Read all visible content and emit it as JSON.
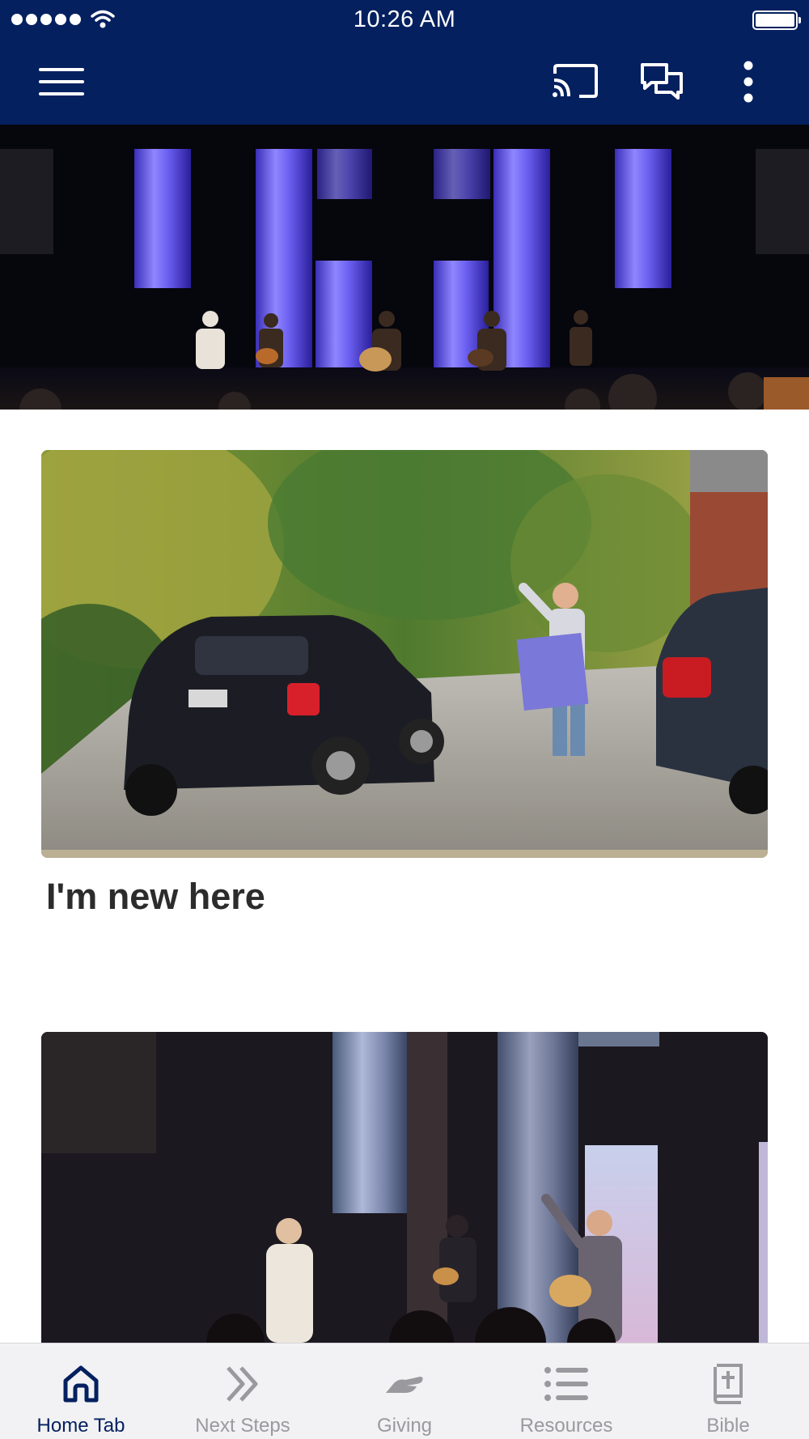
{
  "status_bar": {
    "time": "10:26 AM"
  },
  "header": {
    "menu_icon": "hamburger-icon",
    "cast_icon": "cast-icon",
    "chat_icon": "chat-icon",
    "more_icon": "more-vertical-icon",
    "background_color": "#04205f"
  },
  "cards": [
    {
      "title": "I'm new here",
      "image": "parking-lot-greeter-photo"
    },
    {
      "title": "",
      "image": "worship-band-photo"
    }
  ],
  "hero": {
    "image": "worship-stage-photo"
  },
  "tabs": [
    {
      "label": "Home Tab",
      "icon": "home-icon",
      "active": true
    },
    {
      "label": "Next Steps",
      "icon": "double-chevron-icon",
      "active": false
    },
    {
      "label": "Giving",
      "icon": "giving-hand-icon",
      "active": false
    },
    {
      "label": "Resources",
      "icon": "list-icon",
      "active": false
    },
    {
      "label": "Bible",
      "icon": "bible-icon",
      "active": false
    }
  ],
  "colors": {
    "active_tab": "#04205f",
    "inactive_tab": "#9a9a9e"
  }
}
